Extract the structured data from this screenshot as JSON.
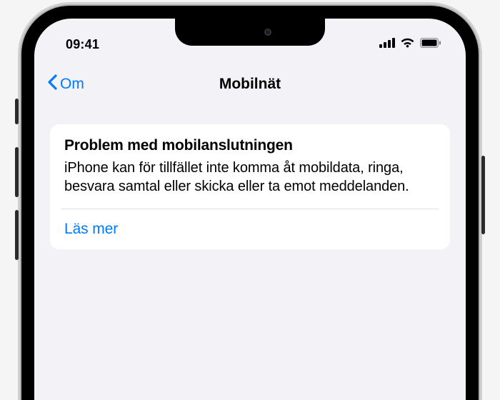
{
  "status": {
    "time": "09:41"
  },
  "nav": {
    "back_label": "Om",
    "title": "Mobilnät"
  },
  "card": {
    "title": "Problem med mobilanslutningen",
    "body": "iPhone kan för tillfället inte komma åt mobildata, ringa, besvara samtal eller skicka eller ta emot meddelanden.",
    "link": "Läs mer"
  }
}
